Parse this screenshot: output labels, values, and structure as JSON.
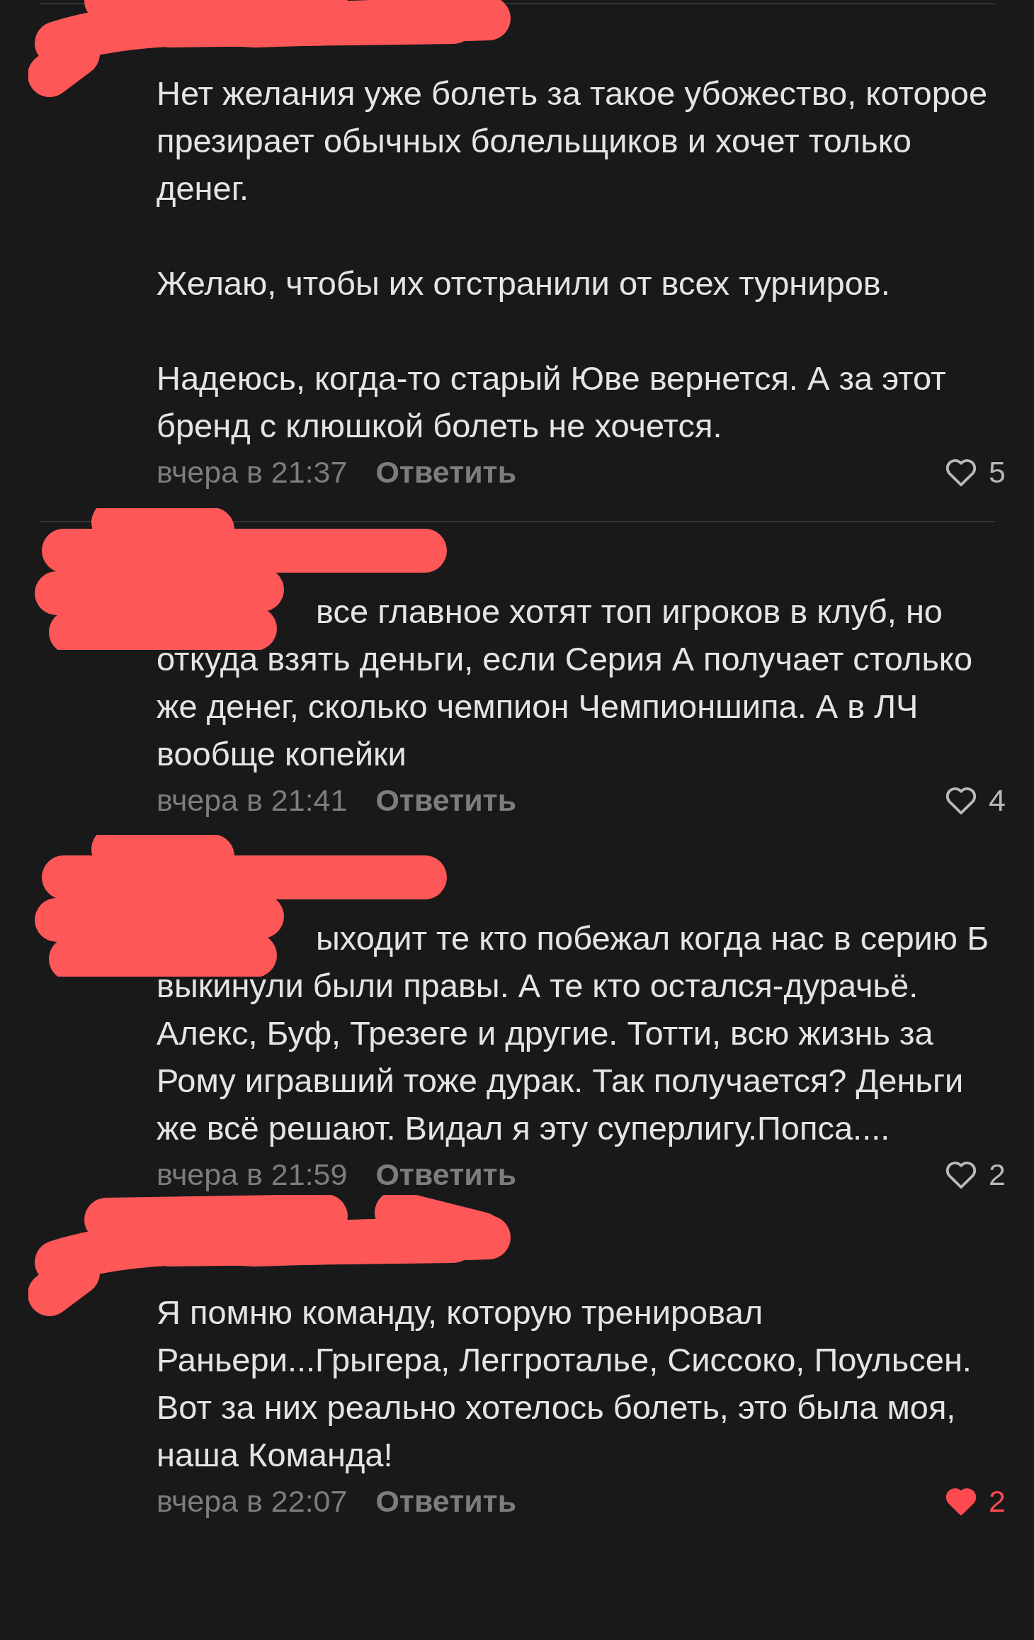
{
  "comments": [
    {
      "separated": true,
      "kind": "plain",
      "text": "Нет желания уже болеть за такое убожество, которое презирает обычных болельщиков и хочет только денег.\n\nЖелаю, чтобы их отстранили от всех турниров.\n\nНадеюсь, когда-то старый Юве вернется. А за этот бренд с клюшкой болеть не хочется.",
      "time": "вчера в 21:37",
      "reply": "Ответить",
      "liked": false,
      "likes": "5"
    },
    {
      "separated": true,
      "kind": "reply",
      "text": "все главное хотят топ игроков в клуб, но откуда взять деньги, если Серия А получает столько же денег, сколько чемпион Чемпионшипа. А в ЛЧ вообще копейки",
      "time": "вчера в 21:41",
      "reply": "Ответить",
      "liked": false,
      "likes": "4"
    },
    {
      "separated": false,
      "kind": "reply",
      "text": "ыходит те кто побежал когда нас в серию Б выкинули были правы. А те кто остался-дурачьё. Алекс, Буф, Трезеге и другие. Тотти, всю жизнь за Рому игравший тоже дурак. Так получается? Деньги же всё решают. Видал я эту суперлигу.Попса....",
      "time": "вчера в 21:59",
      "reply": "Ответить",
      "liked": false,
      "likes": "2"
    },
    {
      "separated": false,
      "kind": "plain",
      "text": "Я помню команду, которую тренировал Раньери...Грыгера, Леггроталье, Сиссоко, Поульсен. Вот за них реально хотелось болеть, это была моя, наша Команда!",
      "time": "вчера в 22:07",
      "reply": "Ответить",
      "liked": true,
      "likes": "2"
    }
  ]
}
